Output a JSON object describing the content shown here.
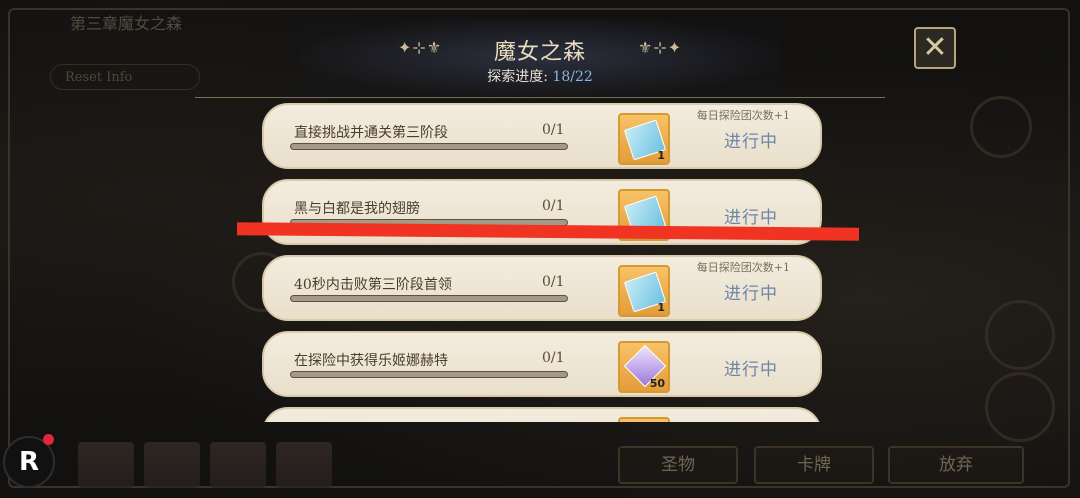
{
  "background": {
    "title": "第三章魔女之森",
    "sub_label": "Reset Info",
    "buttons": [
      "圣物",
      "卡牌",
      "放弃"
    ]
  },
  "header": {
    "title": "魔女之森",
    "ornament_left": "✦⊹⚜",
    "ornament_right": "⚜⊹✦",
    "progress_label": "探索进度:",
    "progress_value": "18/22",
    "close_icon": "✕"
  },
  "missions": [
    {
      "name": "直接挑战并通关第三阶段",
      "count": "0/1",
      "progress": 0.0,
      "reward_type": "ticket-icon",
      "reward_qty": "1",
      "note": "每日探险团次数+1",
      "status": "进行中"
    },
    {
      "name": "黑与白都是我的翅膀",
      "count": "0/1",
      "progress": 0.0,
      "reward_type": "ticket-icon",
      "reward_qty": "",
      "note": "",
      "status": "进行中"
    },
    {
      "name": "40秒内击败第三阶段首领",
      "count": "0/1",
      "progress": 0.0,
      "reward_type": "ticket-icon",
      "reward_qty": "1",
      "note": "每日探险团次数+1",
      "status": "进行中"
    },
    {
      "name": "在探险中获得乐姬娜赫特",
      "count": "0/1",
      "progress": 0.0,
      "reward_type": "gem-icon",
      "reward_qty": "50",
      "note": "",
      "status": "进行中"
    },
    {
      "name": "",
      "count": "",
      "progress": 0.0,
      "reward_type": "",
      "reward_qty": "",
      "note": "",
      "status": ""
    }
  ],
  "overlay": {
    "logo": "R",
    "annotation_color": "#f03322"
  }
}
